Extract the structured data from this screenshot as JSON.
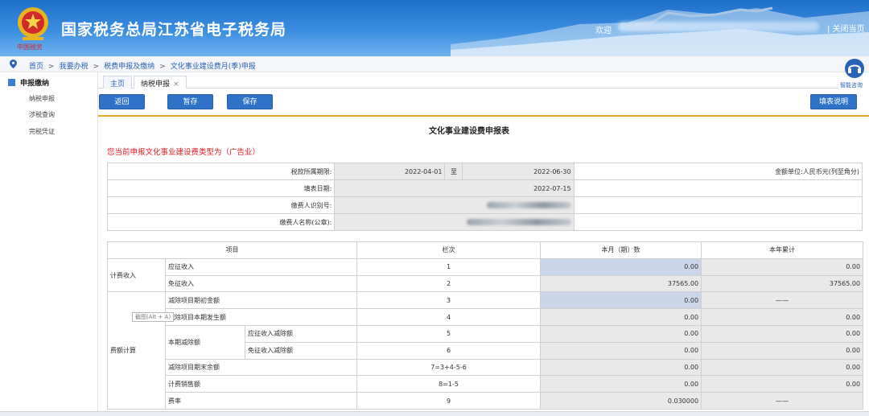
{
  "header": {
    "site_title": "国家税务总局江苏省电子税务局",
    "welcome": "欢迎",
    "close_page": "| 关闭当页"
  },
  "breadcrumb": [
    "首页",
    "我要办税",
    "税费申报及缴纳",
    "文化事业建设费月(季)申报"
  ],
  "breadcrumb_sep": ">",
  "sidebar": {
    "title": "申报缴纳",
    "items": [
      "纳税申报",
      "涉税查询",
      "完税凭证"
    ]
  },
  "support": {
    "label": "智能咨询"
  },
  "tabs": {
    "home": "主页",
    "active": "纳税申报",
    "close": "×"
  },
  "toolbar": {
    "back": "返回",
    "temp_save": "暂存",
    "save": "保存",
    "explain": "填表说明"
  },
  "form": {
    "title": "文化事业建设费申报表",
    "notice": "您当前申报文化事业建设费类型为（广告业）"
  },
  "info": {
    "period_label": "税款所属期限:",
    "period_from": "2022-04-01",
    "period_to_label": "至",
    "period_to": "2022-06-30",
    "unit": "金额单位:人民币元(列至角分)",
    "fill_date_label": "填表日期:",
    "fill_date": "2022-07-15",
    "taxpayer_id_label": "缴费人识别号:",
    "taxpayer_name_label": "缴费人名称(公章):"
  },
  "table": {
    "headers": [
      "项目",
      "栏次",
      "本月（期）数",
      "本年累计"
    ],
    "g1": "计费收入",
    "g2": "费额计算",
    "r1": {
      "label": "应征收入",
      "line": "1",
      "cur": "0.00",
      "ytd": "0.00"
    },
    "r2": {
      "label": "免征收入",
      "line": "2",
      "cur": "37565.00",
      "ytd": "37565.00"
    },
    "r3": {
      "label": "减除项目期初金额",
      "line": "3",
      "cur": "0.00",
      "ytd": "——"
    },
    "r4": {
      "label": "减除项目本期发生额",
      "line": "4",
      "cur": "0.00",
      "ytd": "0.00"
    },
    "deduct_group": "本期减除额",
    "r5": {
      "label": "应征收入减除额",
      "line": "5",
      "cur": "0.00",
      "ytd": "0.00"
    },
    "r6": {
      "label": "免征收入减除额",
      "line": "6",
      "cur": "0.00",
      "ytd": "0.00"
    },
    "r7": {
      "label": "减除项目期末余额",
      "line": "7=3+4-5-6",
      "cur": "0.00",
      "ytd": "0.00"
    },
    "r8": {
      "label": "计费销售额",
      "line": "8=1-5",
      "cur": "0.00",
      "ytd": "0.00"
    },
    "r9": {
      "label": "费率",
      "line": "9",
      "cur": "0.030000",
      "ytd": "——"
    }
  },
  "tooltip": "截图(Alt + A)"
}
